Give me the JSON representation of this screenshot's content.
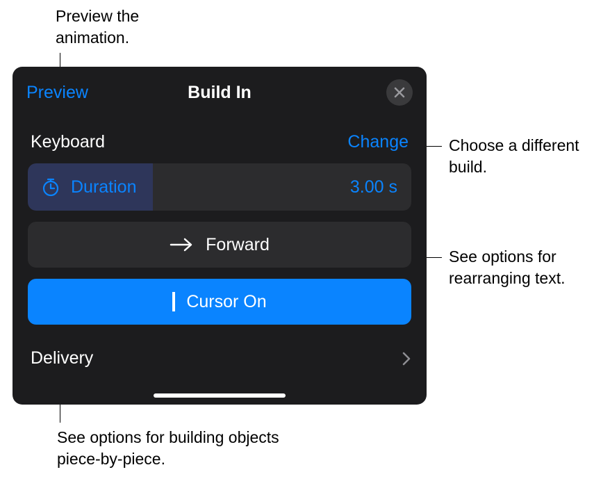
{
  "callouts": {
    "preview": "Preview the animation.",
    "change": "Choose a different build.",
    "forward": "See options for rearranging text.",
    "delivery": "See options for building objects piece-by-piece."
  },
  "panel": {
    "header": {
      "preview": "Preview",
      "title": "Build In"
    },
    "section": {
      "label": "Keyboard",
      "change": "Change"
    },
    "duration": {
      "label": "Duration",
      "value": "3.00 s"
    },
    "direction": {
      "label": "Forward"
    },
    "cursor": {
      "label": "Cursor On"
    },
    "delivery": {
      "label": "Delivery"
    }
  }
}
